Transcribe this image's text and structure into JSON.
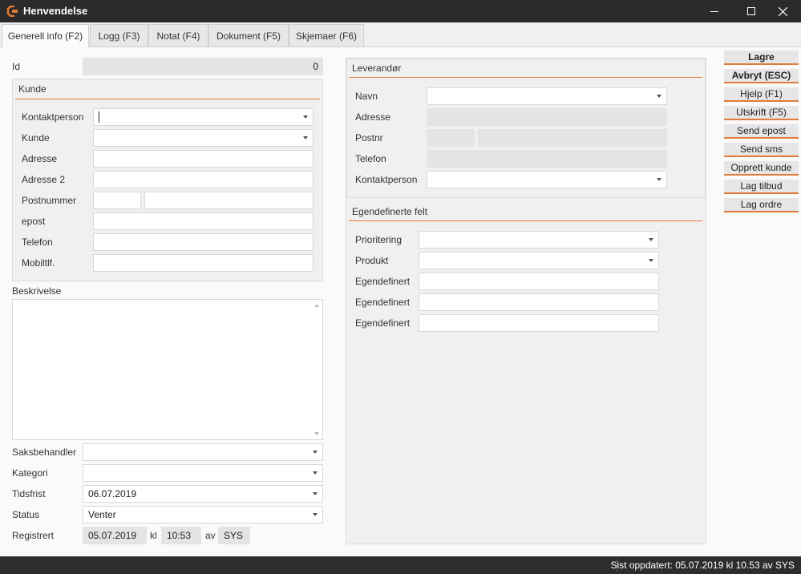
{
  "window": {
    "title": "Henvendelse",
    "minimize": "—",
    "maximize": "☐",
    "close": "✕"
  },
  "tabs": [
    {
      "label": "Generell info (F2)"
    },
    {
      "label": "Logg (F3)"
    },
    {
      "label": "Notat (F4)"
    },
    {
      "label": "Dokument (F5)"
    },
    {
      "label": "Skjemaer (F6)"
    }
  ],
  "id": {
    "label": "Id",
    "value": "0"
  },
  "kunde": {
    "title": "Kunde",
    "kontaktperson": "Kontaktperson",
    "kunde": "Kunde",
    "adresse": "Adresse",
    "adresse2": "Adresse 2",
    "postnummer": "Postnummer",
    "epost": "epost",
    "telefon": "Telefon",
    "mobil": "Mobiltlf."
  },
  "beskrivelse": {
    "label": "Beskrivelse"
  },
  "saksbehandler": {
    "label": "Saksbehandler"
  },
  "kategori": {
    "label": "Kategori"
  },
  "tidsfrist": {
    "label": "Tidsfrist",
    "value": "06.07.2019"
  },
  "status": {
    "label": "Status",
    "value": "Venter"
  },
  "registrert": {
    "label": "Registrert",
    "date": "05.07.2019",
    "kl": "kl",
    "time": "10:53",
    "av": "av",
    "user": "SYS"
  },
  "leverandor": {
    "title": "Leverandør",
    "navn": "Navn",
    "adresse": "Adresse",
    "postnr": "Postnr",
    "telefon": "Telefon",
    "kontaktperson": "Kontaktperson"
  },
  "egendefinerte": {
    "title": "Egendefinerte felt",
    "prioritering": "Prioritering",
    "produkt": "Produkt",
    "egen1": "Egendefinert",
    "egen2": "Egendefinert",
    "egen3": "Egendefinert"
  },
  "sidebuttons": {
    "lagre": "Lagre",
    "avbryt": "Avbryt (ESC)",
    "hjelp": "Hjelp (F1)",
    "utskrift": "Utskrift (F5)",
    "send_epost": "Send epost",
    "send_sms": "Send sms",
    "opprett_kunde": "Opprett kunde",
    "lag_tilbud": "Lag tilbud",
    "lag_ordre": "Lag ordre"
  },
  "statusbar": {
    "text": "Sist oppdatert: 05.07.2019 kl 10.53 av SYS"
  },
  "colors": {
    "accent": "#e07b39",
    "titlebar": "#2b2b2b"
  }
}
